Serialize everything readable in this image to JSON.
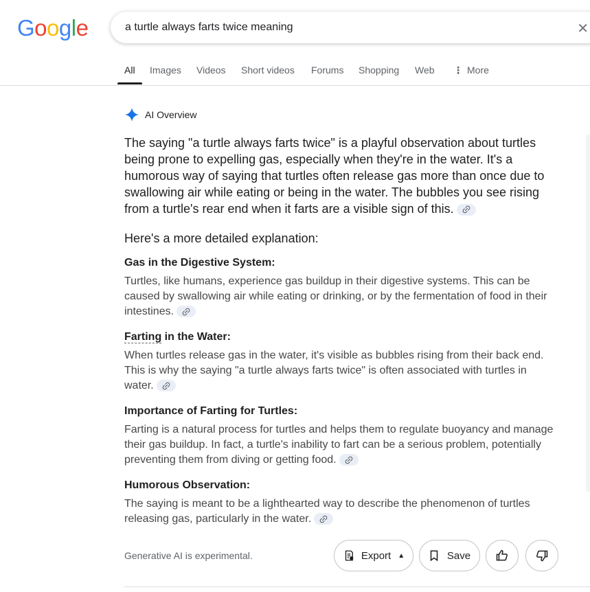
{
  "logo": {
    "text": "Google",
    "letters": [
      {
        "ch": "G",
        "color": "#4285F4"
      },
      {
        "ch": "o",
        "color": "#EA4335"
      },
      {
        "ch": "o",
        "color": "#FBBC05"
      },
      {
        "ch": "g",
        "color": "#4285F4"
      },
      {
        "ch": "l",
        "color": "#34A853"
      },
      {
        "ch": "e",
        "color": "#EA4335"
      }
    ]
  },
  "search": {
    "query": "a turtle always farts twice meaning",
    "clear_icon": "close-icon"
  },
  "tabs": [
    "All",
    "Images",
    "Videos",
    "Short videos",
    "Forums",
    "Shopping",
    "Web",
    "More"
  ],
  "active_tab": "All",
  "ai_overview": {
    "title": "AI Overview",
    "icon": "sparkle-icon",
    "accent_color": "#1a73e8",
    "summary": "The saying \"a turtle always farts twice\" is a playful observation about turtles being prone to expelling gas, especially when they're in the water. It's a humorous way of saying that turtles often release gas more than once due to swallowing air while eating or being in the water. The bubbles you see rising from a turtle's rear end when it farts are a visible sign of this.",
    "detail_heading": "Here's a more detailed explanation:",
    "sections": [
      {
        "title": "Gas in the Digestive System:",
        "body": "Turtles, like humans, experience gas buildup in their digestive systems. This can be caused by swallowing air while eating or drinking, or by the fermentation of food in their intestines."
      },
      {
        "title_underlined": "Farting",
        "title_rest": " in the Water:",
        "body": "When turtles release gas in the water, it's visible as bubbles rising from their back end. This is why the saying \"a turtle always farts twice\" is often associated with turtles in water."
      },
      {
        "title": "Importance of Farting for Turtles:",
        "body": "Farting is a natural process for turtles and helps them to regulate buoyancy and manage their gas buildup. In fact, a turtle's inability to fart can be a serious problem, potentially preventing them from diving or getting food."
      },
      {
        "title": "Humorous Observation:",
        "body": "The saying is meant to be a lighthearted way to describe the phenomenon of turtles releasing gas, particularly in the water."
      }
    ]
  },
  "footer": {
    "disclaimer": "Generative AI is experimental.",
    "export_label": "Export",
    "save_label": "Save"
  }
}
